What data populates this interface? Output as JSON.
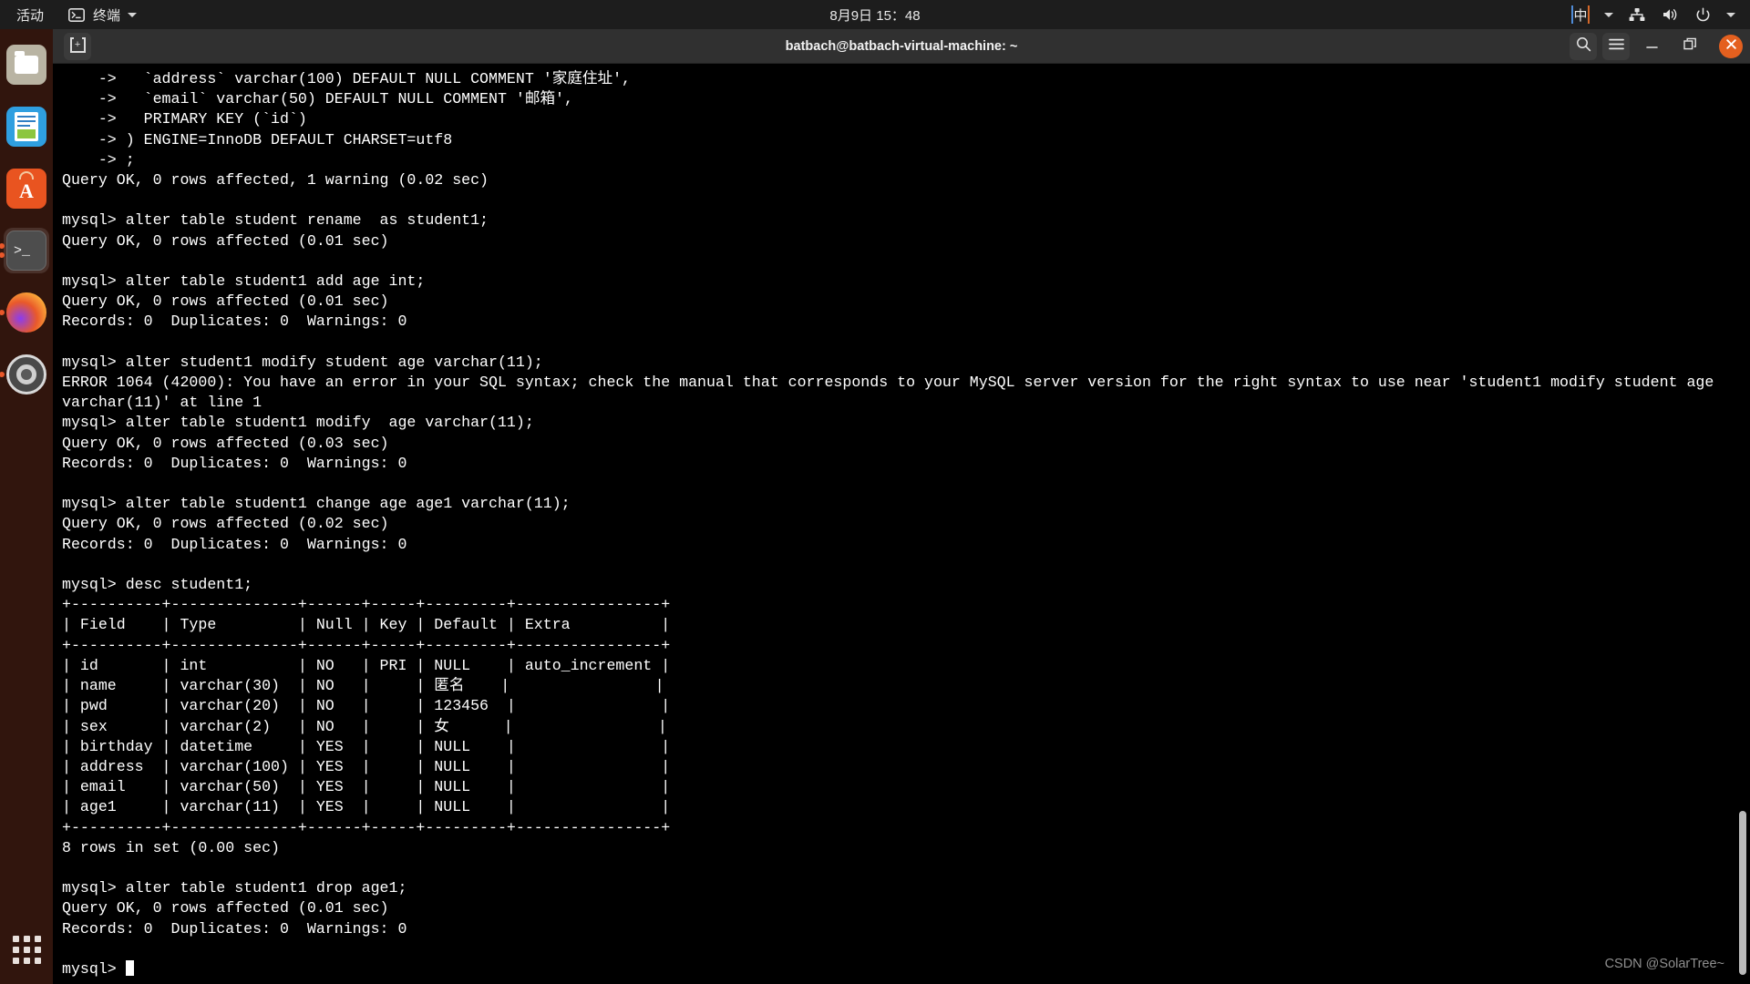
{
  "topbar": {
    "activities": "活动",
    "app_name": "终端",
    "app_icon": "terminal-icon",
    "datetime": "8月9日  15：48",
    "ime": "中",
    "icons": [
      "network-icon",
      "volume-icon",
      "power-icon",
      "chevron-down-icon"
    ]
  },
  "dock": {
    "items": [
      {
        "name": "files",
        "label": "Files",
        "running": false,
        "active": false
      },
      {
        "name": "libreoffice-writer",
        "label": "LibreOffice Writer",
        "running": false,
        "active": false
      },
      {
        "name": "ubuntu-software",
        "label": "Ubuntu Software",
        "running": false,
        "active": false
      },
      {
        "name": "terminal",
        "label": "Terminal",
        "running": true,
        "active": true
      },
      {
        "name": "firefox",
        "label": "Firefox",
        "running": true,
        "active": false
      },
      {
        "name": "settings",
        "label": "Settings",
        "running": true,
        "active": false
      }
    ],
    "show_apps_label": "Show Applications"
  },
  "window": {
    "title": "batbach@batbach-virtual-machine: ~",
    "newtab_label": "+",
    "controls": {
      "search": "search-icon",
      "menu": "hamburger-menu-icon",
      "minimize": "—",
      "maximize": "❐",
      "close": "✕"
    }
  },
  "terminal": {
    "prompt": "mysql>",
    "lines": [
      "    ->   `address` varchar(100) DEFAULT NULL COMMENT '家庭住址',",
      "    ->   `email` varchar(50) DEFAULT NULL COMMENT '邮箱',",
      "    ->   PRIMARY KEY (`id`)",
      "    -> ) ENGINE=InnoDB DEFAULT CHARSET=utf8",
      "    -> ;",
      "Query OK, 0 rows affected, 1 warning (0.02 sec)",
      "",
      "mysql> alter table student rename  as student1;",
      "Query OK, 0 rows affected (0.01 sec)",
      "",
      "mysql> alter table student1 add age int;",
      "Query OK, 0 rows affected (0.01 sec)",
      "Records: 0  Duplicates: 0  Warnings: 0",
      "",
      "mysql> alter student1 modify student age varchar(11);",
      "ERROR 1064 (42000): You have an error in your SQL syntax; check the manual that corresponds to your MySQL server version for the right syntax to use near 'student1 modify student age",
      "varchar(11)' at line 1",
      "mysql> alter table student1 modify  age varchar(11);",
      "Query OK, 0 rows affected (0.03 sec)",
      "Records: 0  Duplicates: 0  Warnings: 0",
      "",
      "mysql> alter table student1 change age age1 varchar(11);",
      "Query OK, 0 rows affected (0.02 sec)",
      "Records: 0  Duplicates: 0  Warnings: 0",
      "",
      "mysql> desc student1;",
      "+----------+--------------+------+-----+---------+----------------+",
      "| Field    | Type         | Null | Key | Default | Extra          |",
      "+----------+--------------+------+-----+---------+----------------+",
      "| id       | int          | NO   | PRI | NULL    | auto_increment |",
      "| name     | varchar(30)  | NO   |     | 匿名    |                |",
      "| pwd      | varchar(20)  | NO   |     | 123456  |                |",
      "| sex      | varchar(2)   | NO   |     | 女      |                |",
      "| birthday | datetime     | YES  |     | NULL    |                |",
      "| address  | varchar(100) | YES  |     | NULL    |                |",
      "| email    | varchar(50)  | YES  |     | NULL    |                |",
      "| age1     | varchar(11)  | YES  |     | NULL    |                |",
      "+----------+--------------+------+-----+---------+----------------+",
      "8 rows in set (0.00 sec)",
      "",
      "mysql> alter table student1 drop age1;",
      "Query OK, 0 rows affected (0.01 sec)",
      "Records: 0  Duplicates: 0  Warnings: 0",
      "",
      "mysql> "
    ],
    "desc_table": {
      "type": "table",
      "columns": [
        "Field",
        "Type",
        "Null",
        "Key",
        "Default",
        "Extra"
      ],
      "rows": [
        [
          "id",
          "int",
          "NO",
          "PRI",
          "NULL",
          "auto_increment"
        ],
        [
          "name",
          "varchar(30)",
          "NO",
          "",
          "匿名",
          ""
        ],
        [
          "pwd",
          "varchar(20)",
          "NO",
          "",
          "123456",
          ""
        ],
        [
          "sex",
          "varchar(2)",
          "NO",
          "",
          "女",
          ""
        ],
        [
          "birthday",
          "datetime",
          "YES",
          "",
          "NULL",
          ""
        ],
        [
          "address",
          "varchar(100)",
          "YES",
          "",
          "NULL",
          ""
        ],
        [
          "email",
          "varchar(50)",
          "YES",
          "",
          "NULL",
          ""
        ],
        [
          "age1",
          "varchar(11)",
          "YES",
          "",
          "NULL",
          ""
        ]
      ],
      "footer": "8 rows in set (0.00 sec)"
    },
    "colors": {
      "background": "#000000",
      "foreground": "#ffffff"
    }
  },
  "watermark": "CSDN @SolarTree~"
}
